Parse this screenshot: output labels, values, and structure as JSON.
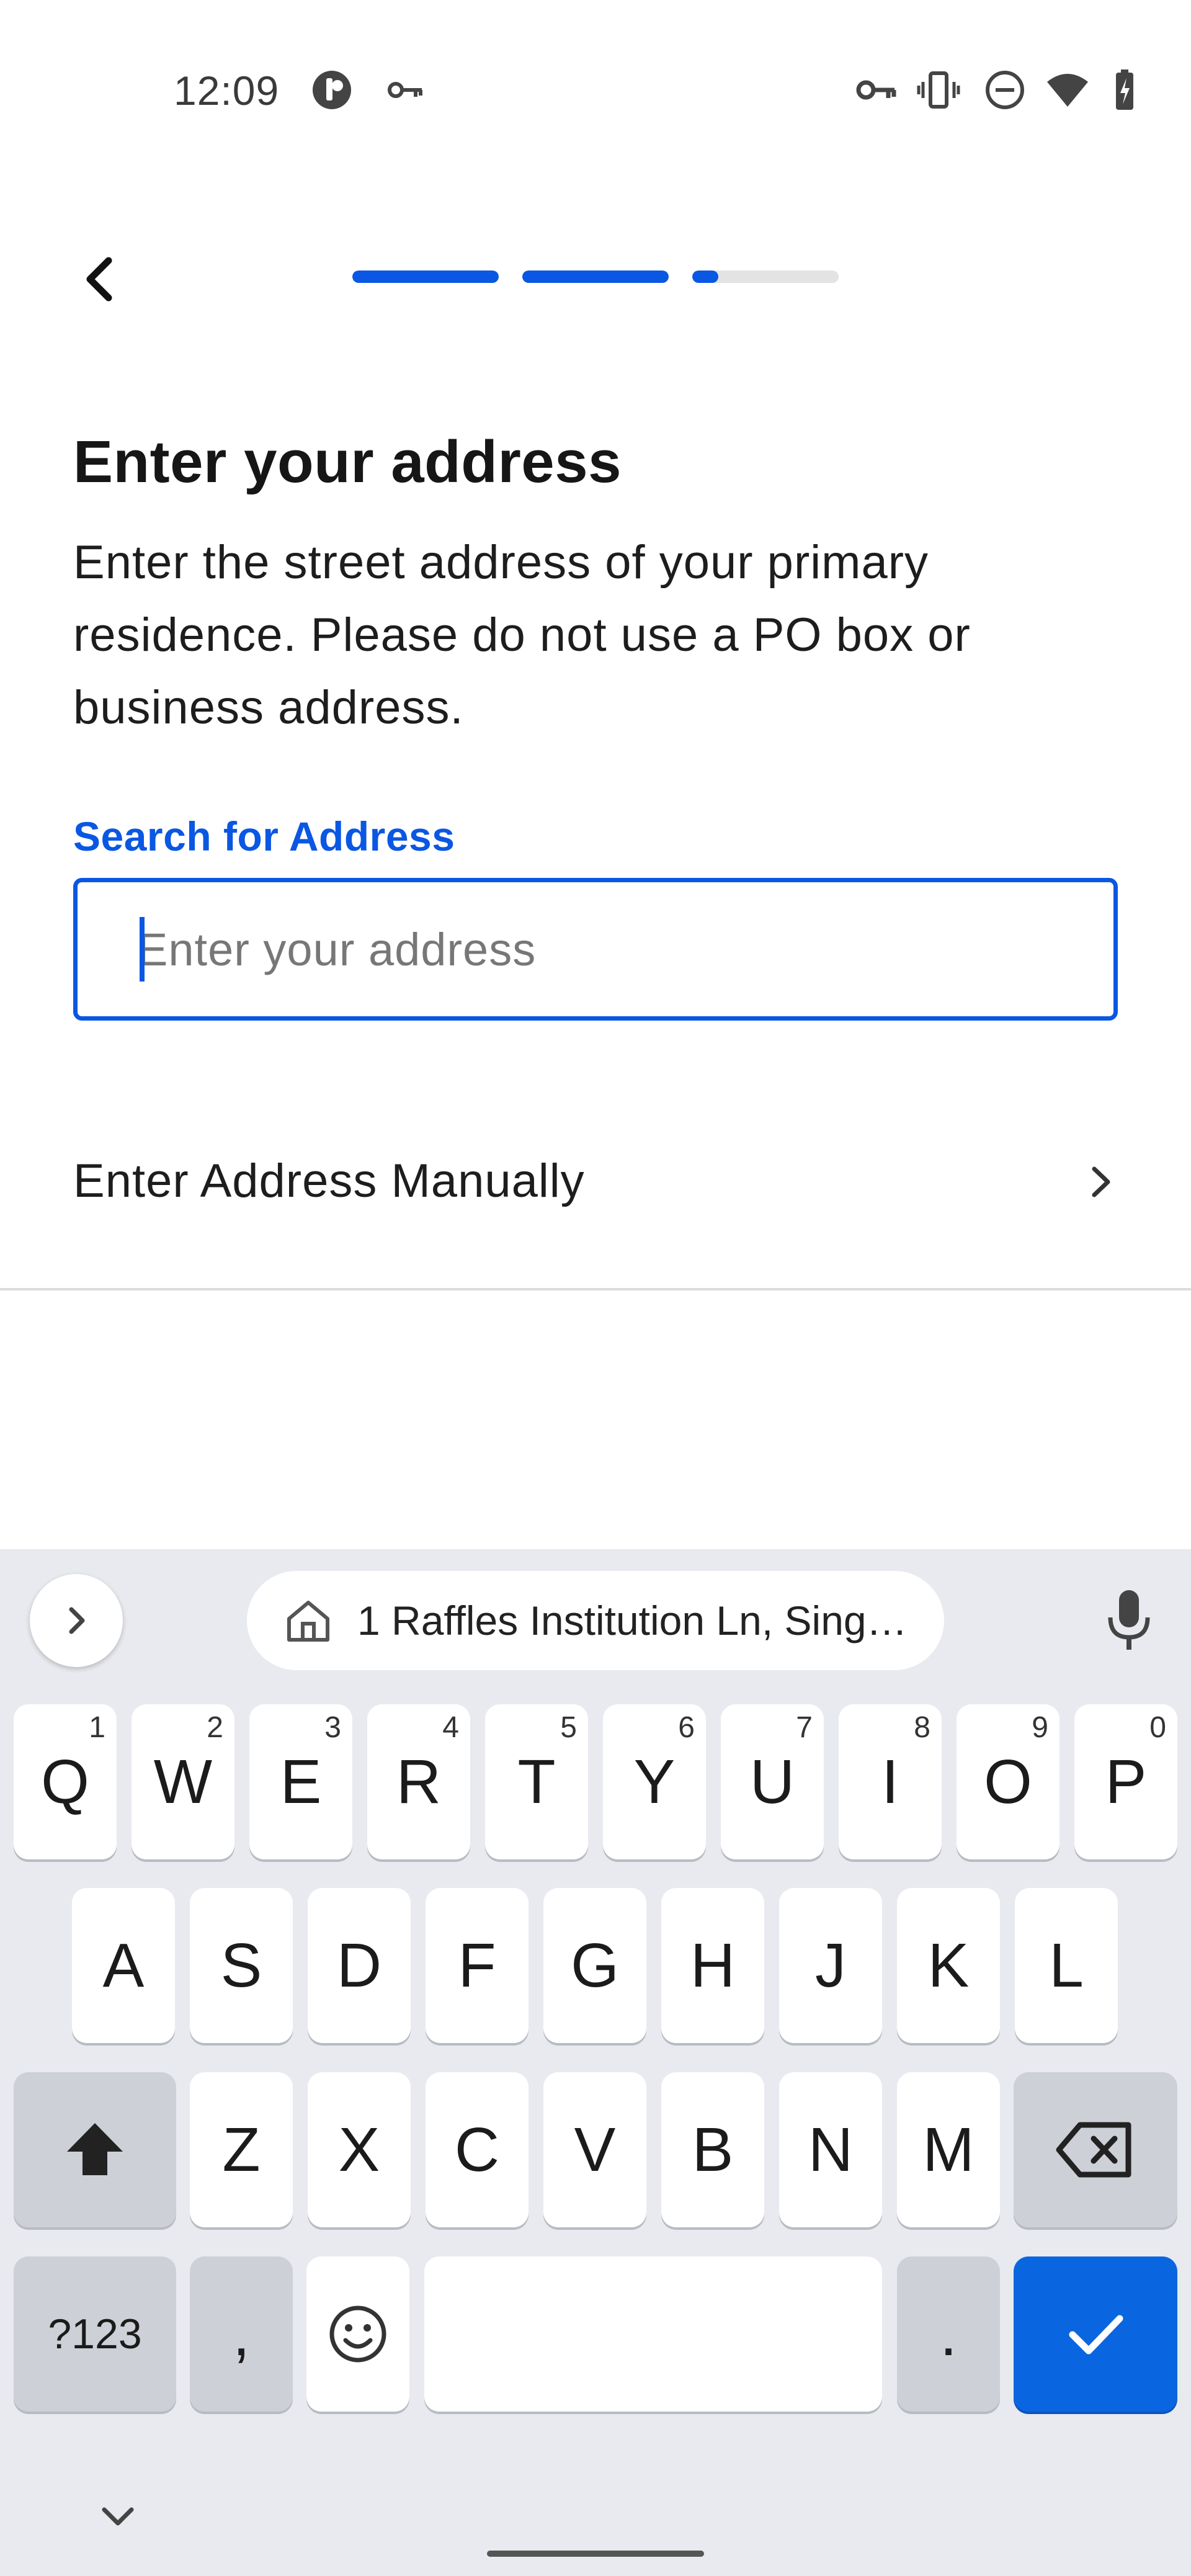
{
  "status_bar": {
    "time": "12:09",
    "icons": [
      "app-notification-icon",
      "vpn-key-icon",
      "vpn-key-icon",
      "vibrate-icon",
      "do-not-disturb-icon",
      "wifi-icon",
      "battery-charging-icon"
    ]
  },
  "header": {
    "back_icon": "chevron-left-icon",
    "progress_steps": [
      1.0,
      1.0,
      0.18
    ],
    "colors": {
      "accent": "#0a57e3",
      "track": "#e3e3e3"
    }
  },
  "main": {
    "title": "Enter your address",
    "description": "Enter the street address of your primary residence. Please do not use a PO box or business address.",
    "field_label": "Search for Address",
    "input_placeholder": "Enter your address",
    "input_value": "",
    "manual_label": "Enter Address Manually"
  },
  "keyboard": {
    "suggestion": "1 Raffles Institution Ln, Sing…",
    "row1": [
      {
        "label": "Q",
        "hint": "1"
      },
      {
        "label": "W",
        "hint": "2"
      },
      {
        "label": "E",
        "hint": "3"
      },
      {
        "label": "R",
        "hint": "4"
      },
      {
        "label": "T",
        "hint": "5"
      },
      {
        "label": "Y",
        "hint": "6"
      },
      {
        "label": "U",
        "hint": "7"
      },
      {
        "label": "I",
        "hint": "8"
      },
      {
        "label": "O",
        "hint": "9"
      },
      {
        "label": "P",
        "hint": "0"
      }
    ],
    "row2": [
      "A",
      "S",
      "D",
      "F",
      "G",
      "H",
      "J",
      "K",
      "L"
    ],
    "row3": [
      "Z",
      "X",
      "C",
      "V",
      "B",
      "N",
      "M"
    ],
    "symbols_label": "?123",
    "comma_label": ",",
    "period_label": ".",
    "colors": {
      "background": "#e8eaef",
      "key": "#ffffff",
      "function_key": "#cdd0d6",
      "enter_key": "#0a66e0"
    }
  }
}
